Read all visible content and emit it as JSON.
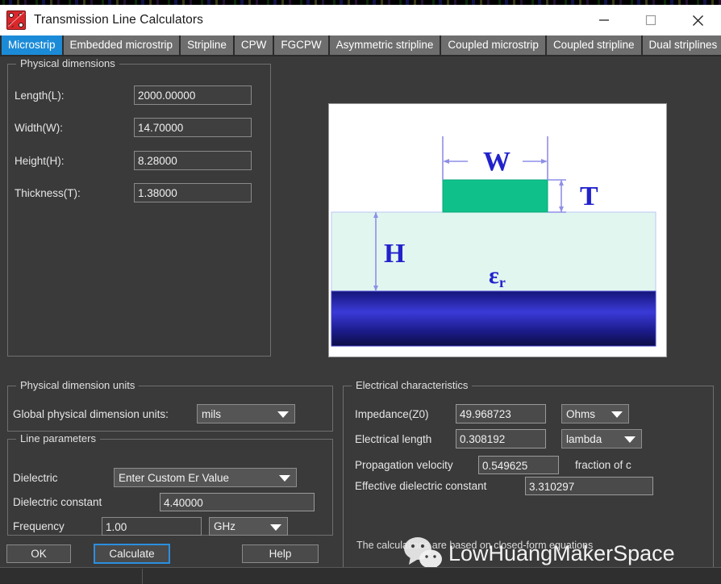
{
  "window": {
    "title": "Transmission Line Calculators",
    "icon": "dice-app-icon",
    "controls": [
      {
        "name": "minimize",
        "glyph": "minimize-icon"
      },
      {
        "name": "maximize",
        "glyph": "maximize-icon"
      },
      {
        "name": "close",
        "glyph": "close-icon"
      }
    ]
  },
  "tabs": [
    {
      "label": "Microstrip",
      "active": true
    },
    {
      "label": "Embedded microstrip",
      "active": false
    },
    {
      "label": "Stripline",
      "active": false
    },
    {
      "label": "CPW",
      "active": false
    },
    {
      "label": "FGCPW",
      "active": false
    },
    {
      "label": "Asymmetric stripline",
      "active": false
    },
    {
      "label": "Coupled microstrip",
      "active": false
    },
    {
      "label": "Coupled stripline",
      "active": false
    },
    {
      "label": "Dual striplines",
      "active": false
    }
  ],
  "physical_dimensions": {
    "title": "Physical dimensions",
    "fields": [
      {
        "label": "Length(L):",
        "value": "2000.00000"
      },
      {
        "label": "Width(W):",
        "value": "14.70000"
      },
      {
        "label": "Height(H):",
        "value": "8.28000"
      },
      {
        "label": "Thickness(T):",
        "value": "1.38000"
      }
    ]
  },
  "diagram": {
    "name": "microstrip-cross-section",
    "labels": {
      "width": "W",
      "thickness": "T",
      "height": "H",
      "epsilon": "ε",
      "epsilon_sub": "r"
    },
    "colors": {
      "trace": "#0fc08a",
      "substrate": "#e2f6f0",
      "ground_top": "#1a1a7a",
      "ground_mid": "#3333cc",
      "ground_bottom": "#0d0d4d",
      "annotation": "#2222cc",
      "dim_line": "#8f8fe8",
      "background": "#ffffff"
    }
  },
  "physical_dimension_units": {
    "title": "Physical dimension units",
    "label": "Global physical dimension units:",
    "value": "mils"
  },
  "line_parameters": {
    "title": "Line parameters",
    "dielectric_label": "Dielectric",
    "dielectric_value": "Enter Custom Er Value",
    "dielectric_constant_label": "Dielectric constant",
    "dielectric_constant_value": "4.40000",
    "frequency_label": "Frequency",
    "frequency_value": "1.00",
    "frequency_unit": "GHz"
  },
  "electrical_characteristics": {
    "title": "Electrical characteristics",
    "impedance_label": "Impedance(Z0)",
    "impedance_value": "49.968723",
    "impedance_unit": "Ohms",
    "electrical_length_label": "Electrical length",
    "electrical_length_value": "0.308192",
    "electrical_length_unit": "lambda",
    "propagation_velocity_label": "Propagation velocity",
    "propagation_velocity_value": "0.549625",
    "propagation_velocity_unit": "fraction of c",
    "effective_dielectric_label": "Effective dielectric constant",
    "effective_dielectric_value": "3.310297",
    "note": "The calculations are based on closed-form equations"
  },
  "buttons": {
    "ok": "OK",
    "calculate": "Calculate",
    "help": "Help"
  },
  "watermark": {
    "logo": "wechat-logo-icon",
    "text": "LowHuangMakerSpace"
  },
  "colors": {
    "accent": "#1b8bd8",
    "window_bg": "#3a3a3a",
    "tabbar_bg": "#2b2b2b",
    "tab_bg": "#6e6e6e",
    "focus_ring": "#2a8fe0"
  }
}
